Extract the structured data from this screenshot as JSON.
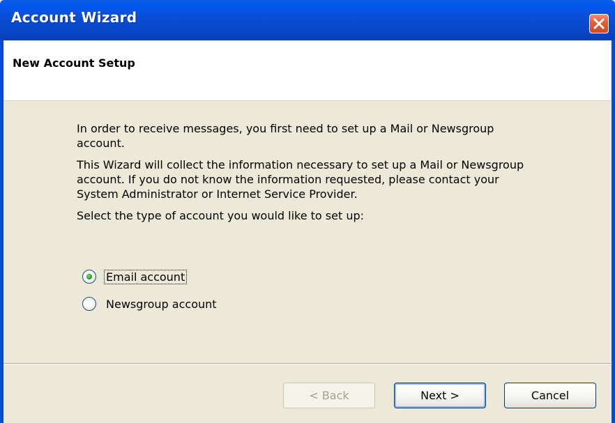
{
  "window": {
    "title": "Account Wizard"
  },
  "header": {
    "title": "New Account Setup"
  },
  "content": {
    "paragraphs": [
      "In order to receive messages, you first need to set up a Mail or Newsgroup account.",
      "This Wizard will collect the information necessary to set up a Mail or Newsgroup account. If you do not know the information requested, please contact your System Administrator or Internet Service Provider.",
      "Select the type of account you would like to set up:"
    ],
    "options": [
      {
        "label": "Email account",
        "selected": true
      },
      {
        "label": "Newsgroup account",
        "selected": false
      }
    ]
  },
  "buttons": {
    "back_label": "< Back",
    "next_label": "Next >",
    "cancel_label": "Cancel"
  },
  "colors": {
    "titlebar": "#0a4fd8",
    "dialog_background": "#ece9d8",
    "close_button": "#e0603c",
    "radio_selected_dot": "#21a121"
  },
  "icons": {
    "close": "close-x-icon"
  }
}
